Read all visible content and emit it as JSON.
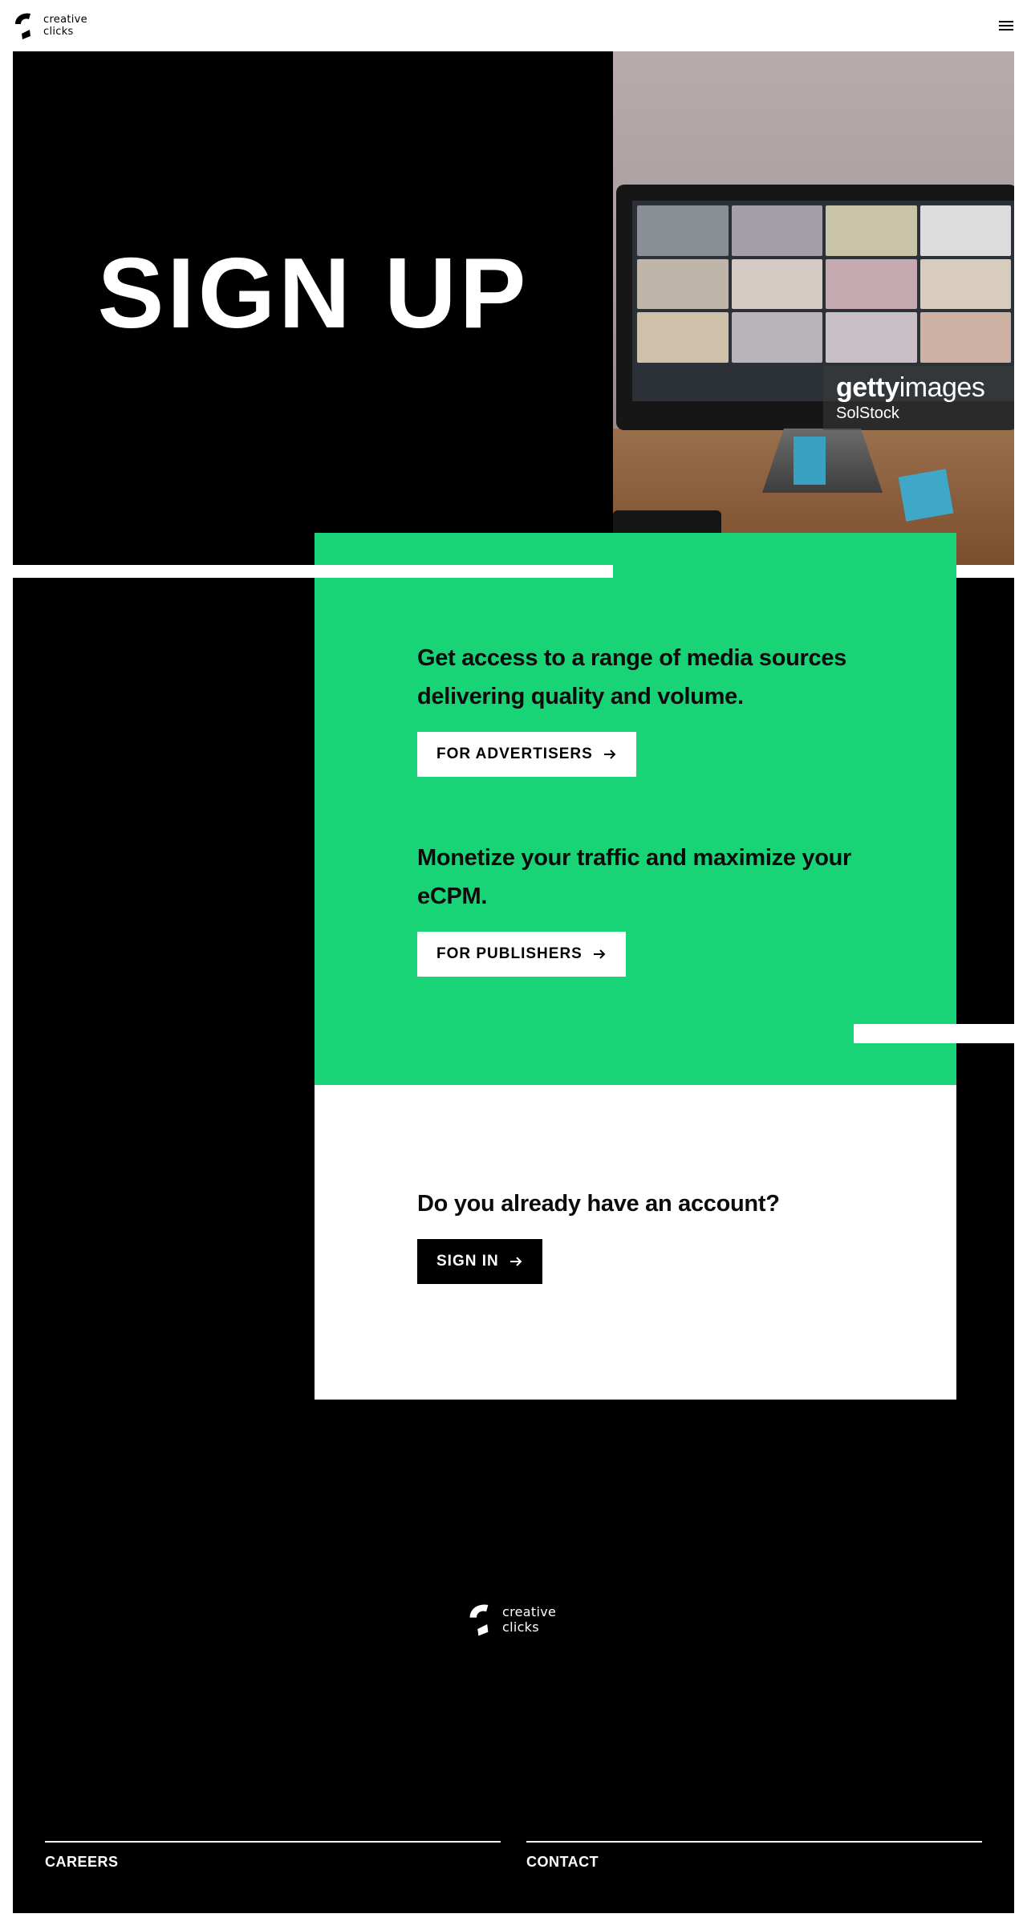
{
  "header": {
    "logo_line1": "creative",
    "logo_line2": "clicks",
    "menu_icon": "hamburger-menu-icon"
  },
  "hero": {
    "title": "SIGN UP",
    "image": {
      "brand_bold": "getty",
      "brand_light": "images",
      "credit": "SolStock"
    }
  },
  "signup": {
    "advertisers": {
      "heading": "Get access to a range of media sources delivering quality and volume.",
      "button_label": "FOR ADVERTISERS"
    },
    "publishers": {
      "heading": "Monetize your traffic and maximize your eCPM.",
      "button_label": "FOR PUBLISHERS"
    },
    "account": {
      "heading": "Do you already have an account?",
      "button_label": "SIGN IN"
    }
  },
  "footer": {
    "logo_line1": "creative",
    "logo_line2": "clicks",
    "links": [
      "CAREERS",
      "CONTACT"
    ]
  },
  "colors": {
    "accent_green": "#18d476",
    "black": "#000000",
    "white": "#ffffff"
  }
}
